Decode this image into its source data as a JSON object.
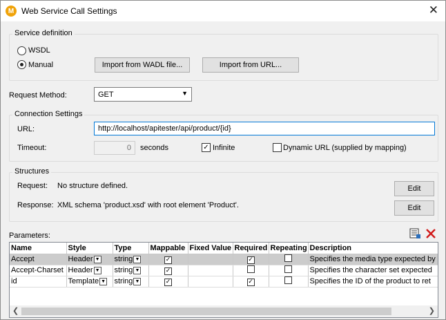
{
  "window": {
    "title": "Web Service Call Settings",
    "close_glyph": "✕",
    "icon": "mapforce-logo-icon"
  },
  "service_definition": {
    "group_label": "Service definition",
    "wsdl_label": "WSDL",
    "manual_label": "Manual",
    "selected": "Manual",
    "import_wadl_button": "Import from WADL file...",
    "import_url_button": "Import from URL..."
  },
  "request_method": {
    "label": "Request Method:",
    "value": "GET"
  },
  "connection": {
    "group_label": "Connection Settings",
    "url_label": "URL:",
    "url_value": "http://localhost/apitester/api/product/{id}",
    "timeout_label": "Timeout:",
    "timeout_value": "0",
    "seconds_label": "seconds",
    "infinite_label": "Infinite",
    "infinite_checked": true,
    "dynamic_url_label": "Dynamic URL (supplied by mapping)",
    "dynamic_url_checked": false
  },
  "structures": {
    "group_label": "Structures",
    "request_label": "Request:",
    "request_value": "No structure defined.",
    "response_label": "Response:",
    "response_value": "XML schema 'product.xsd' with root element 'Product'.",
    "edit_label": "Edit"
  },
  "parameters": {
    "label": "Parameters:",
    "icons": [
      "add-parameter-icon",
      "delete-icon"
    ],
    "columns": [
      "Name",
      "Style",
      "Type",
      "Mappable",
      "Fixed Value",
      "Required",
      "Repeating",
      "Description"
    ],
    "rows": [
      {
        "name": "Accept",
        "style": "Header",
        "type": "string",
        "mappable": true,
        "fixed_value": "",
        "required": true,
        "repeating": false,
        "description": "Specifies the media type expected by",
        "selected": true
      },
      {
        "name": "Accept-Charset",
        "style": "Header",
        "type": "string",
        "mappable": true,
        "fixed_value": "",
        "required": false,
        "repeating": false,
        "description": "Specifies the character set expected",
        "selected": false
      },
      {
        "name": "id",
        "style": "Template",
        "type": "string",
        "mappable": true,
        "fixed_value": "",
        "required": true,
        "repeating": false,
        "description": "Specifies the ID of the product to ret",
        "selected": false
      }
    ]
  },
  "colors": {
    "selected_row": "#cccccc",
    "focus_border": "#0078d7",
    "delete_red": "#d11a1a"
  }
}
